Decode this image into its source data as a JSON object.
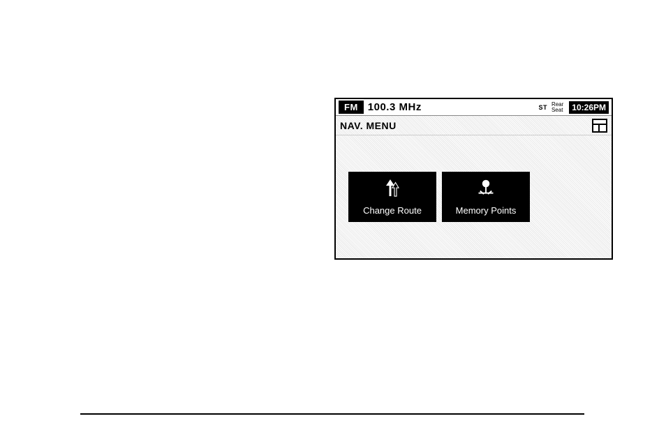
{
  "status": {
    "band": "FM",
    "frequency": "100.3 MHz",
    "st": "ST",
    "rear_seat_line1": "Rear",
    "rear_seat_line2": "Seat",
    "clock": "10:26PM"
  },
  "title": "NAV. MENU",
  "buttons": {
    "change_route": "Change Route",
    "memory_points": "Memory Points"
  }
}
